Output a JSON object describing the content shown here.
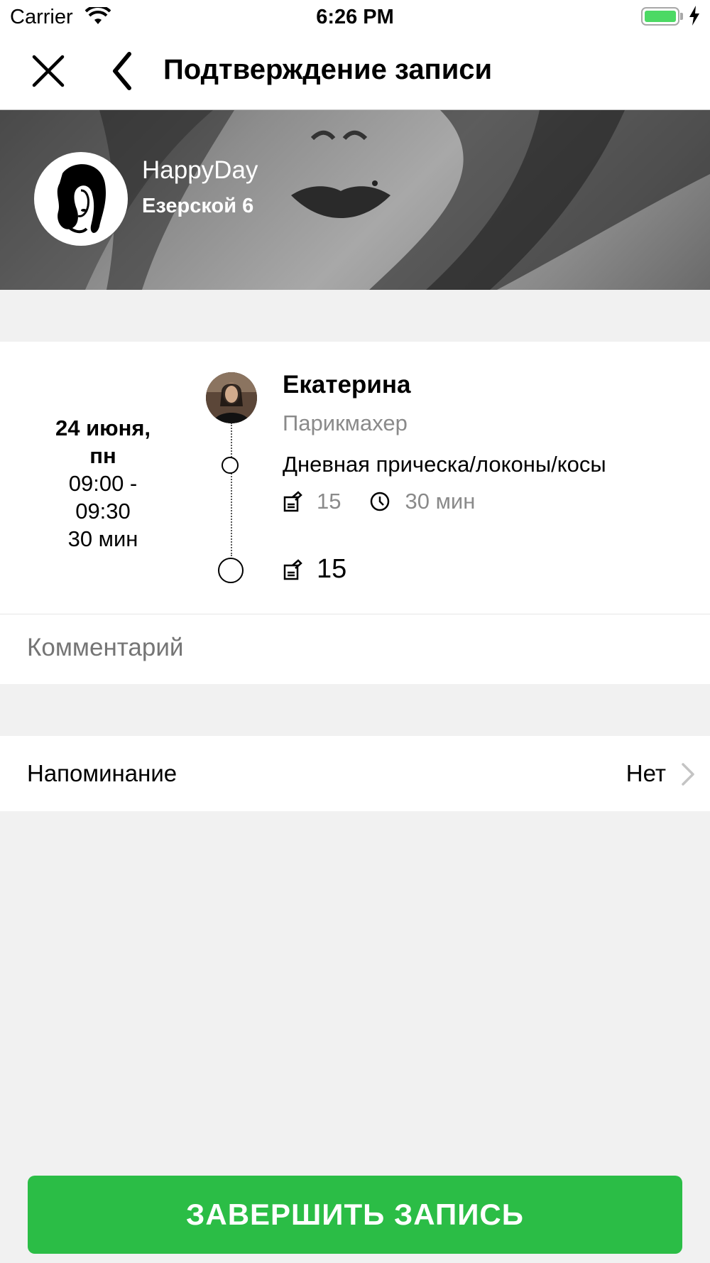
{
  "status_bar": {
    "carrier": "Carrier",
    "time": "6:26 PM",
    "battery_color": "#4cd964"
  },
  "nav": {
    "title": "Подтверждение записи",
    "close_icon": "close-icon",
    "back_icon": "chevron-left-icon"
  },
  "salon": {
    "name": "HappyDay",
    "address": "Езерской 6"
  },
  "appointment": {
    "date_line1": "24 июня,",
    "date_line2": "пн",
    "time_range_line1": "09:00 -",
    "time_range_line2": "09:30",
    "duration": "30 мин",
    "master": {
      "name": "Екатерина",
      "role": "Парикмахер"
    },
    "service": {
      "name": "Дневная прическа/локоны/косы",
      "price": "15",
      "duration": "30 мин"
    },
    "total": "15"
  },
  "comment": {
    "placeholder": "Комментарий"
  },
  "reminder": {
    "label": "Напоминание",
    "value": "Нет"
  },
  "finish_button": {
    "label": "ЗАВЕРШИТЬ ЗАПИСЬ",
    "color": "#2bbd46"
  }
}
